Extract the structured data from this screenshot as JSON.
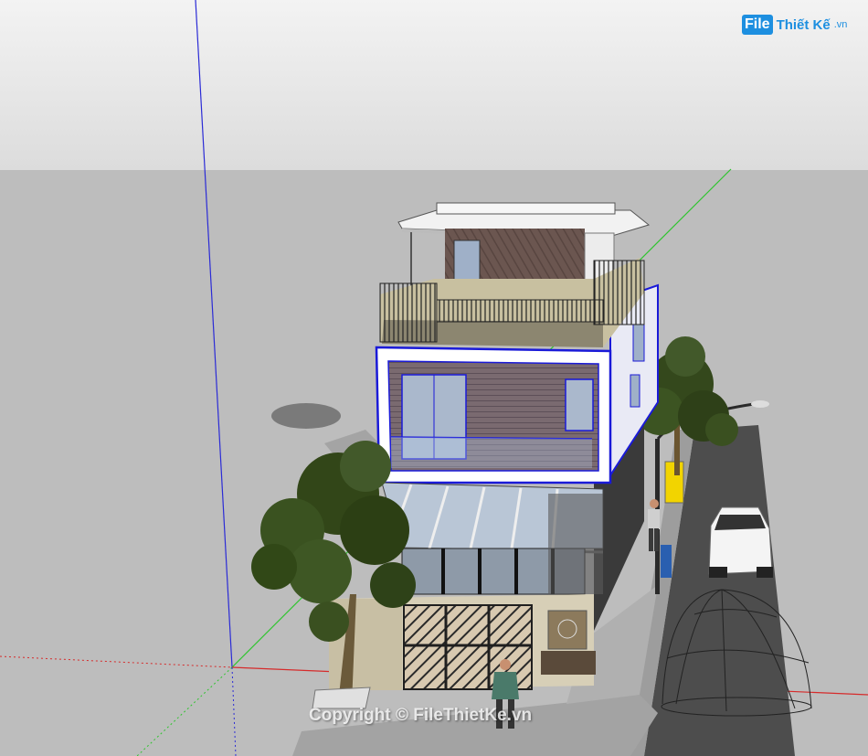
{
  "brand": {
    "logo_box": "File",
    "logo_text": "Thiết Kế",
    "logo_suffix": ".vn"
  },
  "watermark": "Copyright © FileThietKe.vn",
  "colors": {
    "sky": "#e8e8e8",
    "ground": "#bdbdbd",
    "axis_blue": "#2b2bd6",
    "axis_green": "#2ec42e",
    "axis_red": "#d62b2b",
    "selection_blue": "#1a1ad8",
    "brand_blue": "#1d8fe0"
  }
}
